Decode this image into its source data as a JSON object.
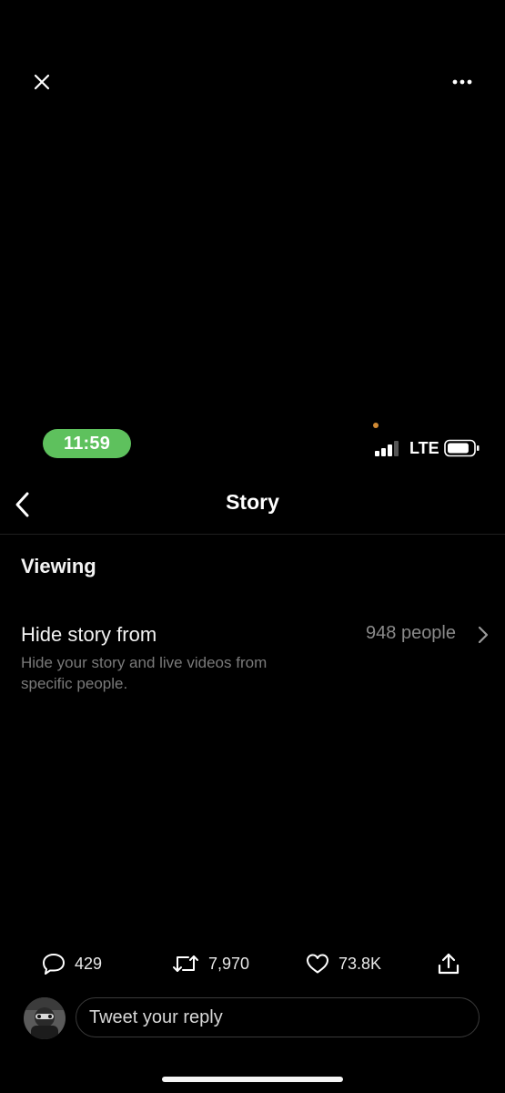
{
  "viewer": {
    "close_icon": "close-icon",
    "more_icon": "more-horizontal-icon"
  },
  "status_bar": {
    "time": "11:59",
    "time_pill_color": "#5ec15d",
    "mic_dot_color": "#d08a34",
    "network": "LTE",
    "signal_bars_filled": 3,
    "signal_bars_total": 4,
    "battery_level": 0.85
  },
  "header": {
    "back_icon": "chevron-left-icon",
    "title": "Story"
  },
  "section": {
    "title": "Viewing"
  },
  "setting": {
    "label": "Hide story from",
    "value": "948 people",
    "description": "Hide your story and live videos from specific people.",
    "chevron_icon": "chevron-right-icon"
  },
  "actions": {
    "replies": "429",
    "retweets": "7,970",
    "likes": "73.8K",
    "share_icon": "share-icon"
  },
  "reply": {
    "placeholder": "Tweet your reply"
  }
}
